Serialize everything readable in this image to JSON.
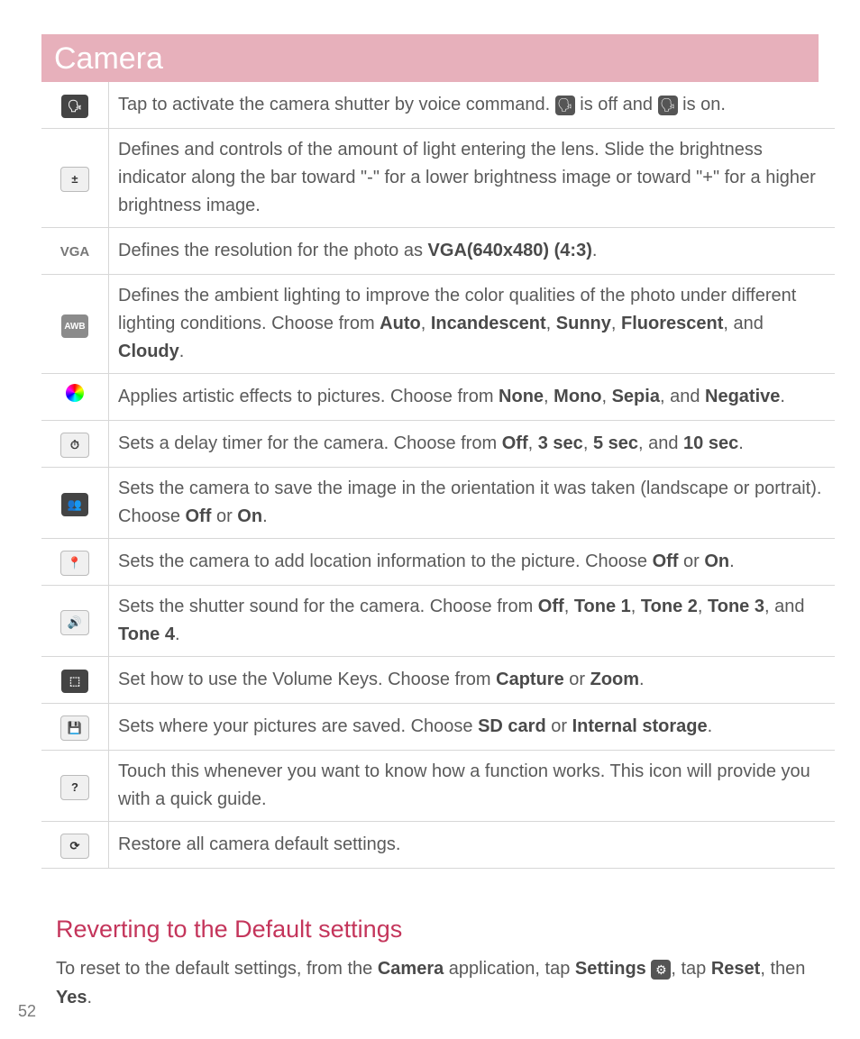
{
  "header": {
    "title": "Camera"
  },
  "rows": [
    {
      "icon": "voice-off-icon",
      "html": "Tap to activate the camera shutter by voice command. <span class='inline-icon' data-name='voice-off-icon'>🗣</span> is off and <span class='inline-icon' data-name='voice-on-icon'>🗣</span> is on."
    },
    {
      "icon": "brightness-icon",
      "html": "Defines and controls of the amount of light entering the lens. Slide the brightness indicator along the bar toward \"-\" for a lower brightness image or toward \"+\" for a higher brightness image."
    },
    {
      "icon": "vga-icon",
      "html": "Defines the resolution for the photo as <b>VGA(640x480) (4:3)</b>."
    },
    {
      "icon": "awb-icon",
      "html": "Defines the ambient lighting to improve the color qualities of the photo under different lighting conditions. Choose from <b>Auto</b>, <b>Incandescent</b>, <b>Sunny</b>, <b>Fluorescent</b>, and <b>Cloudy</b>."
    },
    {
      "icon": "color-effect-icon",
      "html": "Applies artistic effects to pictures. Choose from <b>None</b>, <b>Mono</b>, <b>Sepia</b>, and <b>Negative</b>."
    },
    {
      "icon": "timer-icon",
      "html": "Sets a delay timer for the camera. Choose from <b>Off</b>, <b>3 sec</b>, <b>5 sec</b>, and <b>10 sec</b>."
    },
    {
      "icon": "orientation-icon",
      "html": "Sets the camera to save the image in the orientation it was taken (landscape or portrait). Choose <b>Off</b> or <b>On</b>."
    },
    {
      "icon": "geotag-icon",
      "html": "Sets the camera to add location information to the picture. Choose <b>Off</b> or <b>On</b>."
    },
    {
      "icon": "shutter-sound-icon",
      "html": "Sets the shutter sound for the camera. Choose from <b>Off</b>, <b>Tone 1</b>, <b>Tone 2</b>, <b>Tone 3</b>, and <b>Tone 4</b>."
    },
    {
      "icon": "volume-key-icon",
      "html": "Set how to use the Volume Keys. Choose from <b>Capture</b> or <b>Zoom</b>."
    },
    {
      "icon": "storage-icon",
      "html": "Sets where your pictures are saved. Choose <b>SD card</b> or <b>Internal storage</b>."
    },
    {
      "icon": "help-icon",
      "html": "Touch this whenever you want to know how a function works. This icon will provide you with a quick guide."
    },
    {
      "icon": "reset-icon",
      "html": "Restore all camera default settings."
    }
  ],
  "section": {
    "heading": "Reverting to the Default settings",
    "body_html": "To reset to the default settings, from the <b>Camera</b> application, tap <b>Settings</b> <span class='inline-icon' data-name='settings-gear-icon'>⚙</span>, tap <b>Reset</b>, then <b>Yes</b>."
  },
  "page_number": "52",
  "icon_render": {
    "voice-off-icon": "<span class='icon-box dark'>🗣</span>",
    "brightness-icon": "<span class='icon-box plain'>±</span>",
    "vga-icon": "<span class='icon-box vga'>VGA</span>",
    "awb-icon": "<span class='icon-box awb'>AWB</span>",
    "color-effect-icon": "<span class='color-circle'></span>",
    "timer-icon": "<span class='icon-box plain'>⏱</span>",
    "orientation-icon": "<span class='icon-box dark'>👥</span>",
    "geotag-icon": "<span class='icon-box plain'>📍</span>",
    "shutter-sound-icon": "<span class='icon-box plain'>🔊</span>",
    "volume-key-icon": "<span class='icon-box dark'>⬚</span>",
    "storage-icon": "<span class='icon-box plain'>💾</span>",
    "help-icon": "<span class='icon-box plain'>?</span>",
    "reset-icon": "<span class='icon-box plain'>⟳</span>"
  }
}
